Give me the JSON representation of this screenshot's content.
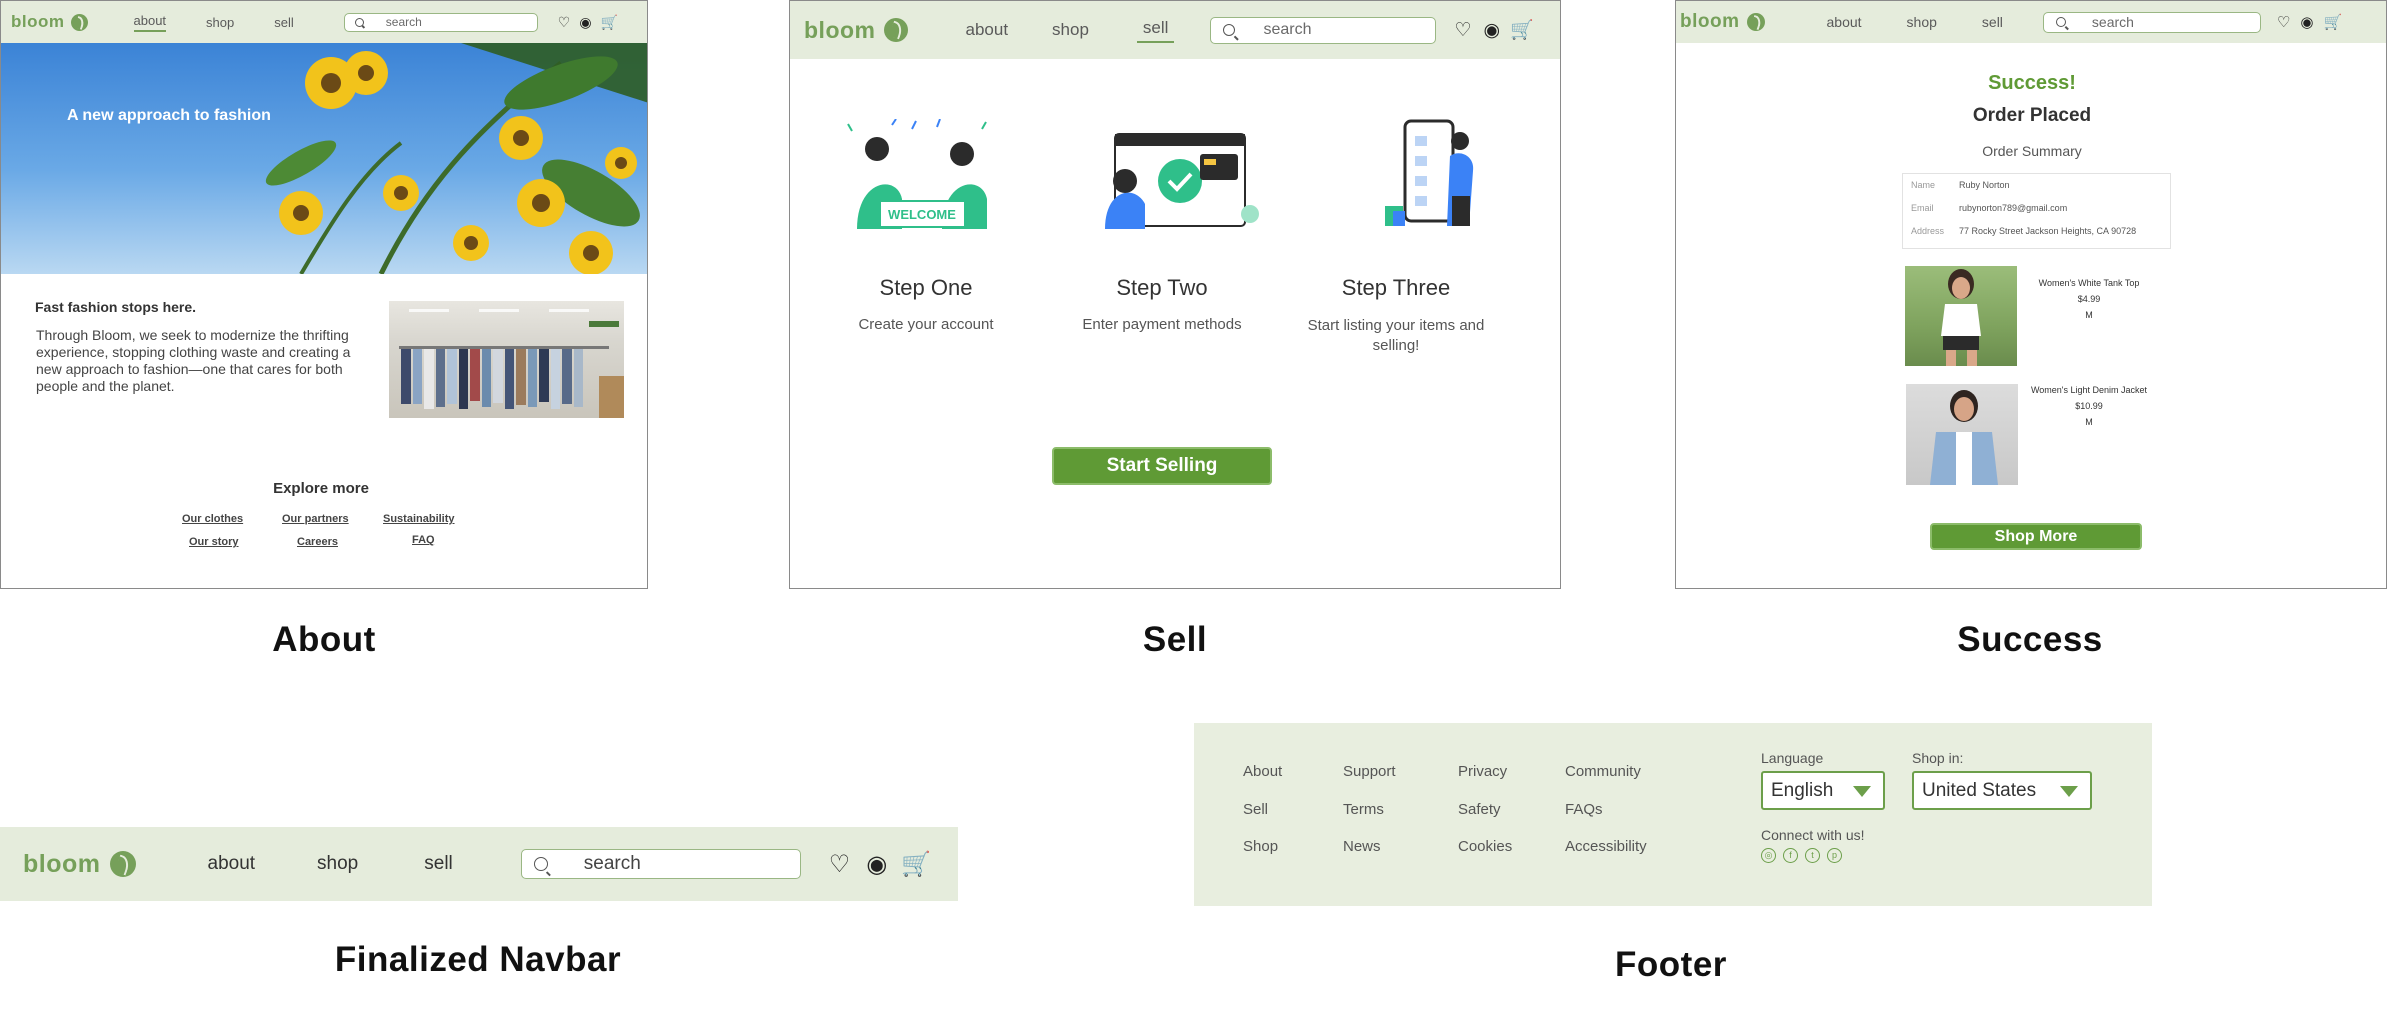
{
  "colors": {
    "brand": "#76a05a",
    "nav_bg": "#e5ecdc",
    "button": "#5f9a35",
    "footer_bg": "#e8eedf"
  },
  "about_screen": {
    "nav": {
      "logo": "bloom",
      "links": [
        "about",
        "shop",
        "sell"
      ],
      "search_placeholder": "search"
    },
    "hero_text": "A new approach to fashion",
    "heading": "Fast fashion stops here.",
    "body": "Through Bloom, we seek to modernize the thrifting experience, stopping clothing waste and creating a new approach to fashion—one that cares for both people and the planet.",
    "explore_title": "Explore more",
    "explore_links": [
      "Our clothes",
      "Our partners",
      "Sustainability",
      "Our story",
      "Careers",
      "FAQ"
    ]
  },
  "sell_screen": {
    "nav": {
      "logo": "bloom",
      "links": [
        "about",
        "shop",
        "sell"
      ],
      "search_placeholder": "search"
    },
    "steps": [
      {
        "title": "Step One",
        "desc": "Create your account",
        "badge": "WELCOME"
      },
      {
        "title": "Step Two",
        "desc": "Enter payment methods"
      },
      {
        "title": "Step Three",
        "desc": "Start listing your items and selling!"
      }
    ],
    "cta": "Start Selling"
  },
  "success_screen": {
    "nav": {
      "logo": "bloom",
      "links": [
        "about",
        "shop",
        "sell"
      ],
      "search_placeholder": "search"
    },
    "success": "Success!",
    "order_placed": "Order Placed",
    "summary": "Order Summary",
    "fields": [
      {
        "label": "Name",
        "value": "Ruby Norton"
      },
      {
        "label": "Email",
        "value": "rubynorton789@gmail.com"
      },
      {
        "label": "Address",
        "value": "77 Rocky Street Jackson Heights, CA 90728"
      }
    ],
    "items": [
      {
        "name": "Women's White Tank Top",
        "price": "$4.99",
        "size": "M"
      },
      {
        "name": "Women's Light Denim Jacket",
        "price": "$10.99",
        "size": "M"
      }
    ],
    "cta": "Shop More"
  },
  "final_navbar": {
    "logo": "bloom",
    "links": [
      "about",
      "shop",
      "sell"
    ],
    "search_placeholder": "search"
  },
  "footer": {
    "col1": [
      "About",
      "Sell",
      "Shop"
    ],
    "col2": [
      "Support",
      "Terms",
      "News"
    ],
    "col3": [
      "Privacy",
      "Safety",
      "Cookies"
    ],
    "col4": [
      "Community",
      "FAQs",
      "Accessibility"
    ],
    "language_label": "Language",
    "language_value": "English",
    "shop_label": "Shop in:",
    "shop_value": "United States",
    "connect": "Connect with us!"
  },
  "captions": {
    "about": "About",
    "sell": "Sell",
    "success": "Success",
    "navbar": "Finalized Navbar",
    "footer": "Footer"
  }
}
